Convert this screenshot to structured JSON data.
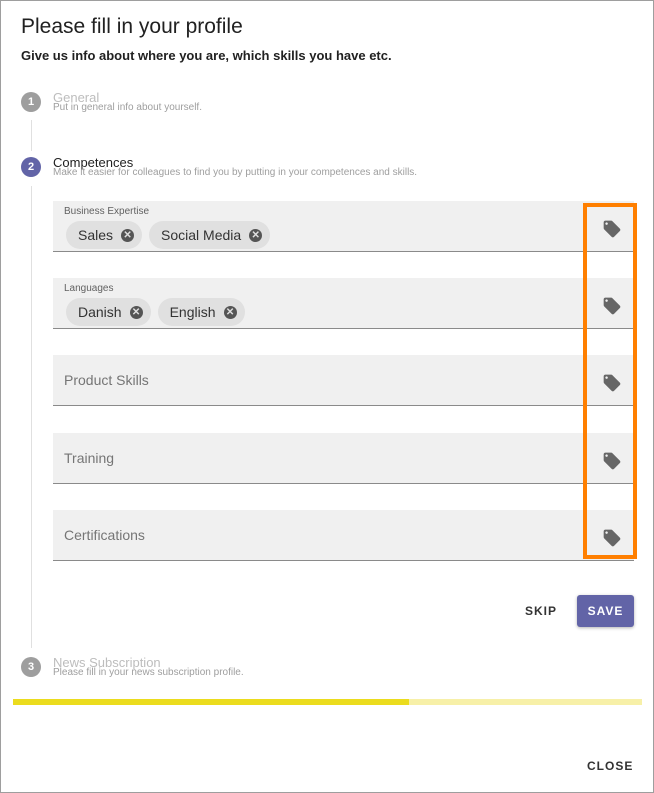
{
  "dialog": {
    "title": "Please fill in your profile",
    "subtitle": "Give us info about where you are, which skills you have etc."
  },
  "steps": [
    {
      "number": "1",
      "title": "General",
      "description": "Put in general info about yourself.",
      "state": "inactive"
    },
    {
      "number": "2",
      "title": "Competences",
      "description": "Make it easier for colleagues to find you by putting in your competences and skills.",
      "state": "active"
    },
    {
      "number": "3",
      "title": "News Subscription",
      "description": "Please fill in your news subscription profile.",
      "state": "inactive"
    }
  ],
  "fields": [
    {
      "label": "Business Expertise",
      "chips": [
        "Sales",
        "Social Media"
      ],
      "icon": "tag-icon"
    },
    {
      "label": "Languages",
      "chips": [
        "Danish",
        "English"
      ],
      "icon": "tag-icon"
    },
    {
      "placeholder": "Product Skills",
      "icon": "tag-icon"
    },
    {
      "placeholder": "Training",
      "icon": "tag-icon"
    },
    {
      "placeholder": "Certifications",
      "icon": "tag-icon"
    }
  ],
  "actions": {
    "skip": "SKIP",
    "save": "SAVE",
    "close": "CLOSE"
  },
  "progress": {
    "fraction": 0.63
  },
  "colors": {
    "accent": "#6264a7",
    "highlight": "#ff7f00",
    "progress": "#ebdc1e",
    "progress_track": "#f7f0a8"
  }
}
